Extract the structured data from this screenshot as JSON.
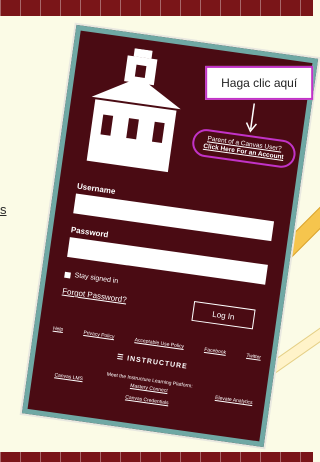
{
  "background": {
    "left_fragment_text": "s"
  },
  "callout": {
    "text": "Haga clic aquí"
  },
  "login": {
    "parent_link_line1": "Parent of a Canvas User?",
    "parent_link_line2": "Click Here For an Account",
    "username_label": "Username",
    "password_label": "Password",
    "stay_signed_in": "Stay signed in",
    "forgot_password": "Forgot Password?",
    "login_button": "Log In"
  },
  "footer": {
    "links": [
      "Help",
      "Privacy Policy",
      "Acceptable Use Policy",
      "Facebook",
      "Twitter"
    ],
    "brand": "INSTRUCTURE",
    "meet_text": "Meet the Instructure Learning Platform:",
    "platform_links": [
      "Canvas LMS",
      "Mastery Connect",
      "Elevate Analytics"
    ],
    "credentials_link": "Canvas Credentials"
  },
  "colors": {
    "card_bg": "#4a0b13",
    "card_border": "#6fa8a4",
    "highlight": "#c233c7",
    "page_bg": "#fbfbe6",
    "brick": "#7a1518"
  },
  "icons": {
    "schoolhouse": "schoolhouse-icon",
    "arrow": "arrow-down-icon",
    "instructure_logo": "instructure-logo-icon"
  }
}
